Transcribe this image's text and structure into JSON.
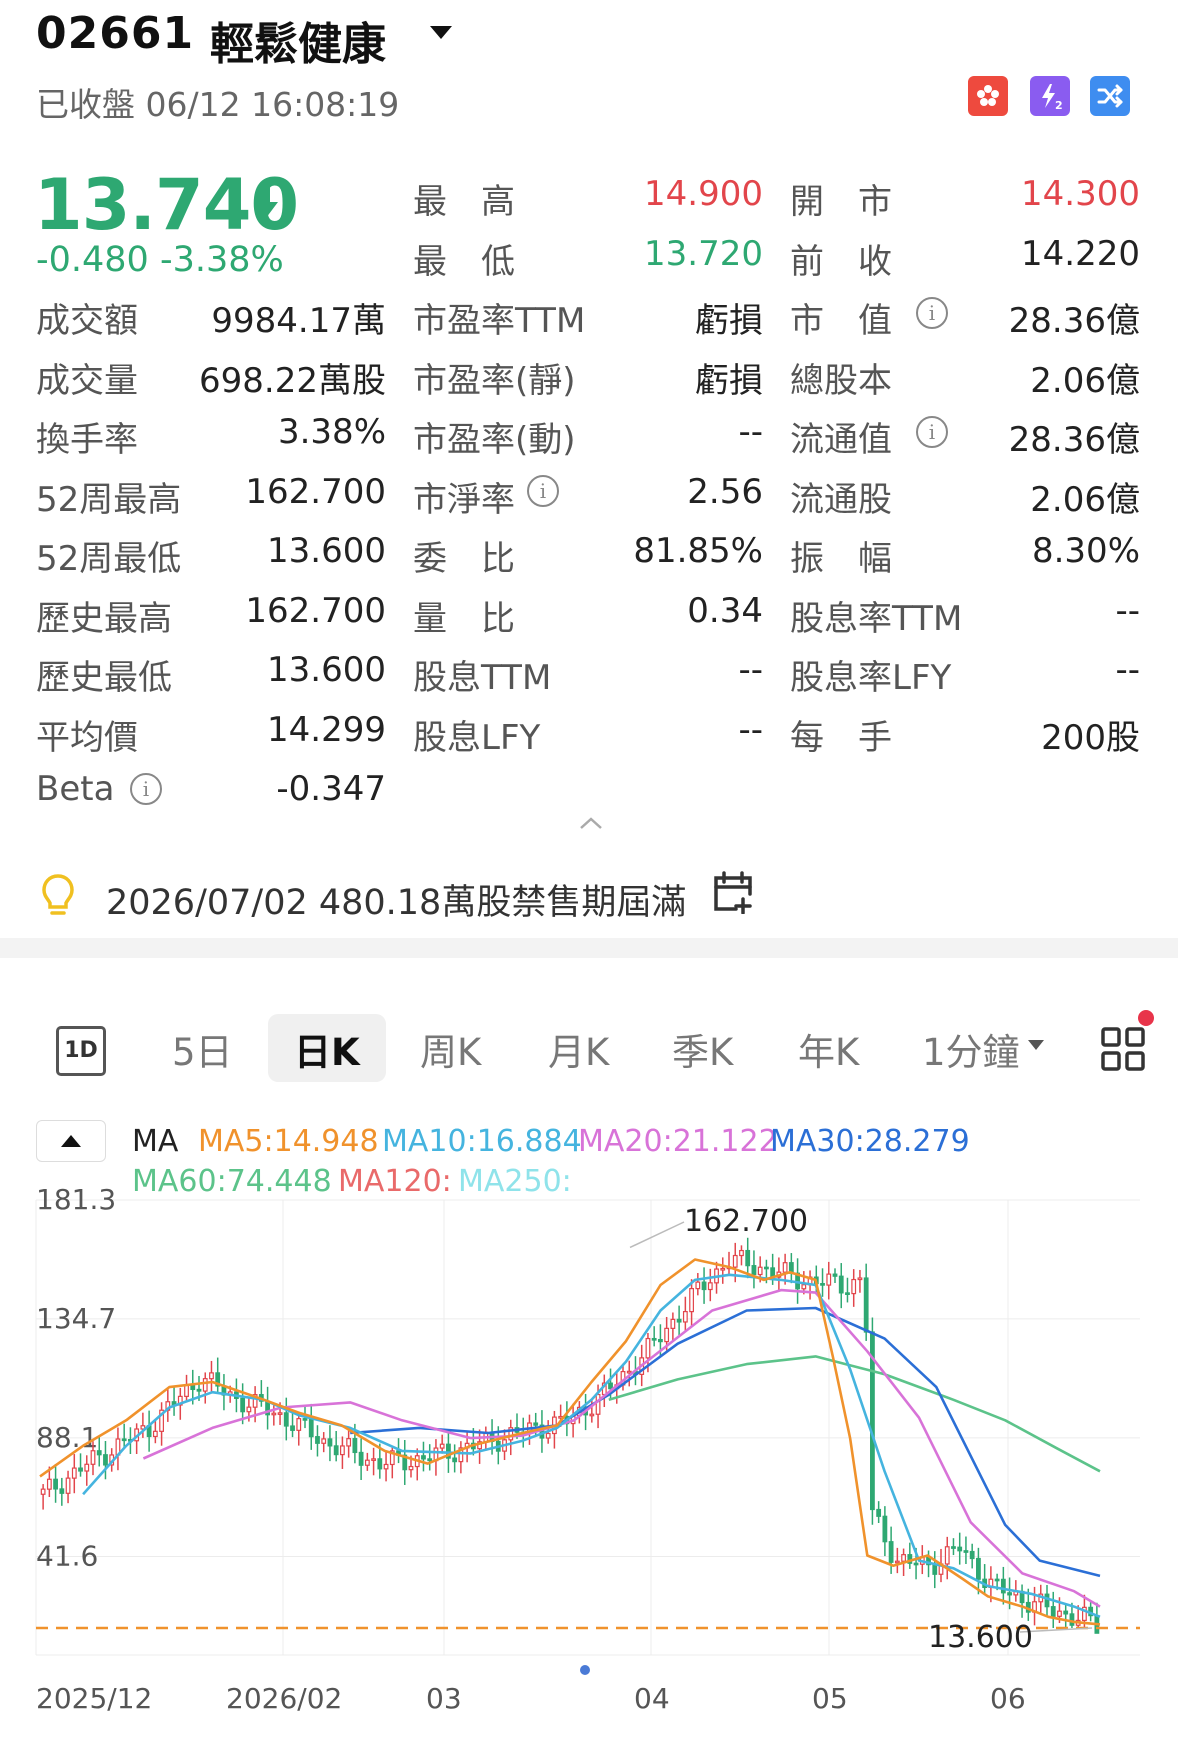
{
  "header": {
    "code": "02661",
    "name": "輕鬆健康",
    "status": "已收盤 06/12 16:08:19"
  },
  "quote": {
    "price": "13.740",
    "change": "-0.480 -3.38%",
    "colors": {
      "up": "#e2454b",
      "down": "#2ea872"
    }
  },
  "stats": {
    "col1": [
      {
        "label": "成交額",
        "value": "9984.17萬"
      },
      {
        "label": "成交量",
        "value": "698.22萬股"
      },
      {
        "label": "換手率",
        "value": "3.38%"
      },
      {
        "label": "52周最高",
        "value": "162.700"
      },
      {
        "label": "52周最低",
        "value": "13.600"
      },
      {
        "label": "歷史最高",
        "value": "162.700"
      },
      {
        "label": "歷史最低",
        "value": "13.600"
      },
      {
        "label": "平均價",
        "value": "14.299"
      },
      {
        "label": "Beta",
        "value": "-0.347"
      }
    ],
    "col2": [
      {
        "label": "最　高",
        "value": "14.900"
      },
      {
        "label": "最　低",
        "value": "13.720"
      },
      {
        "label": "市盈率TTM",
        "value": "虧損"
      },
      {
        "label": "市盈率(靜)",
        "value": "虧損"
      },
      {
        "label": "市盈率(動)",
        "value": "--"
      },
      {
        "label": "市淨率",
        "value": "2.56"
      },
      {
        "label": "委　比",
        "value": "81.85%"
      },
      {
        "label": "量　比",
        "value": "0.34"
      },
      {
        "label": "股息TTM",
        "value": "--"
      },
      {
        "label": "股息LFY",
        "value": "--"
      }
    ],
    "col3": [
      {
        "label": "開　市",
        "value": "14.300"
      },
      {
        "label": "前　收",
        "value": "14.220"
      },
      {
        "label": "市　值",
        "value": "28.36億"
      },
      {
        "label": "總股本",
        "value": "2.06億"
      },
      {
        "label": "流通值",
        "value": "28.36億"
      },
      {
        "label": "流通股",
        "value": "2.06億"
      },
      {
        "label": "振　幅",
        "value": "8.30%"
      },
      {
        "label": "股息率TTM",
        "value": "--"
      },
      {
        "label": "股息率LFY",
        "value": "--"
      },
      {
        "label": "每　手",
        "value": "200股"
      }
    ]
  },
  "notice": {
    "text": "2026/07/02 480.18萬股禁售期屆滿"
  },
  "tabs": {
    "oned": "1D",
    "items": [
      "5日",
      "日K",
      "周K",
      "月K",
      "季K",
      "年K",
      "1分鐘"
    ],
    "active": "日K"
  },
  "ma": {
    "label": "MA",
    "ma5": "MA5:14.948",
    "ma10": "MA10:16.884",
    "ma20": "MA20:21.122",
    "ma30": "MA30:28.279",
    "ma60": "MA60:74.448",
    "ma120": "MA120:",
    "ma250": "MA250:",
    "colors": {
      "ma5": "#f0922c",
      "ma10": "#45b4df",
      "ma20": "#d873d8",
      "ma30": "#2b6fd6",
      "ma60": "#5cc38a",
      "ma120": "#e96a6a",
      "ma250": "#8fe3ea"
    }
  },
  "chart_data": {
    "type": "candlestick",
    "y_ticks": [
      "181.3",
      "134.7",
      "88.1",
      "41.6"
    ],
    "ylim": [
      13.6,
      181.3
    ],
    "x_ticks": [
      "2025/12",
      "2026/02",
      "03",
      "04",
      "05",
      "06"
    ],
    "high_label": "162.700",
    "low_label": "13.600",
    "reference_line": 13.6,
    "ma_series": {
      "ma5": [
        [
          0,
          73
        ],
        [
          0.05,
          85
        ],
        [
          0.1,
          95
        ],
        [
          0.15,
          108
        ],
        [
          0.2,
          110
        ],
        [
          0.26,
          103
        ],
        [
          0.3,
          98
        ],
        [
          0.35,
          93
        ],
        [
          0.4,
          83
        ],
        [
          0.45,
          78
        ],
        [
          0.5,
          85
        ],
        [
          0.56,
          90
        ],
        [
          0.6,
          93
        ],
        [
          0.64,
          110
        ],
        [
          0.68,
          126
        ],
        [
          0.72,
          148
        ],
        [
          0.76,
          158
        ],
        [
          0.8,
          155
        ],
        [
          0.84,
          150
        ],
        [
          0.87,
          153
        ],
        [
          0.9,
          150
        ],
        [
          0.92,
          120
        ],
        [
          0.94,
          88
        ],
        [
          0.96,
          42
        ],
        [
          0.99,
          38
        ],
        [
          1.03,
          42
        ],
        [
          1.07,
          33
        ],
        [
          1.1,
          26
        ],
        [
          1.14,
          22
        ],
        [
          1.17,
          18
        ],
        [
          1.2,
          16
        ],
        [
          1.23,
          15
        ]
      ],
      "ma10": [
        [
          0.05,
          66
        ],
        [
          0.1,
          85
        ],
        [
          0.15,
          100
        ],
        [
          0.2,
          106
        ],
        [
          0.26,
          103
        ],
        [
          0.3,
          97
        ],
        [
          0.36,
          92
        ],
        [
          0.42,
          83
        ],
        [
          0.5,
          82
        ],
        [
          0.56,
          87
        ],
        [
          0.6,
          92
        ],
        [
          0.64,
          103
        ],
        [
          0.68,
          118
        ],
        [
          0.72,
          138
        ],
        [
          0.76,
          150
        ],
        [
          0.8,
          152
        ],
        [
          0.86,
          150
        ],
        [
          0.9,
          148
        ],
        [
          0.94,
          115
        ],
        [
          0.98,
          75
        ],
        [
          1.02,
          40
        ],
        [
          1.06,
          37
        ],
        [
          1.1,
          30
        ],
        [
          1.15,
          27
        ],
        [
          1.2,
          22
        ],
        [
          1.23,
          18
        ]
      ],
      "ma20": [
        [
          0.12,
          80
        ],
        [
          0.2,
          92
        ],
        [
          0.28,
          100
        ],
        [
          0.36,
          102
        ],
        [
          0.42,
          95
        ],
        [
          0.5,
          88
        ],
        [
          0.56,
          89
        ],
        [
          0.62,
          95
        ],
        [
          0.7,
          117
        ],
        [
          0.78,
          138
        ],
        [
          0.86,
          146
        ],
        [
          0.9,
          145
        ],
        [
          0.96,
          122
        ],
        [
          1.02,
          96
        ],
        [
          1.08,
          55
        ],
        [
          1.14,
          35
        ],
        [
          1.2,
          28
        ],
        [
          1.23,
          22
        ]
      ],
      "ma30": [
        [
          0.36,
          90
        ],
        [
          0.44,
          92
        ],
        [
          0.52,
          90
        ],
        [
          0.6,
          93
        ],
        [
          0.66,
          105
        ],
        [
          0.74,
          125
        ],
        [
          0.82,
          138
        ],
        [
          0.9,
          139
        ],
        [
          0.98,
          127
        ],
        [
          1.04,
          108
        ],
        [
          1.12,
          54
        ],
        [
          1.16,
          40
        ],
        [
          1.23,
          34
        ]
      ],
      "ma60": [
        [
          0.66,
          103
        ],
        [
          0.74,
          111
        ],
        [
          0.82,
          117
        ],
        [
          0.9,
          120
        ],
        [
          0.98,
          113
        ],
        [
          1.06,
          103
        ],
        [
          1.12,
          95
        ],
        [
          1.18,
          84
        ],
        [
          1.23,
          75
        ]
      ]
    }
  }
}
